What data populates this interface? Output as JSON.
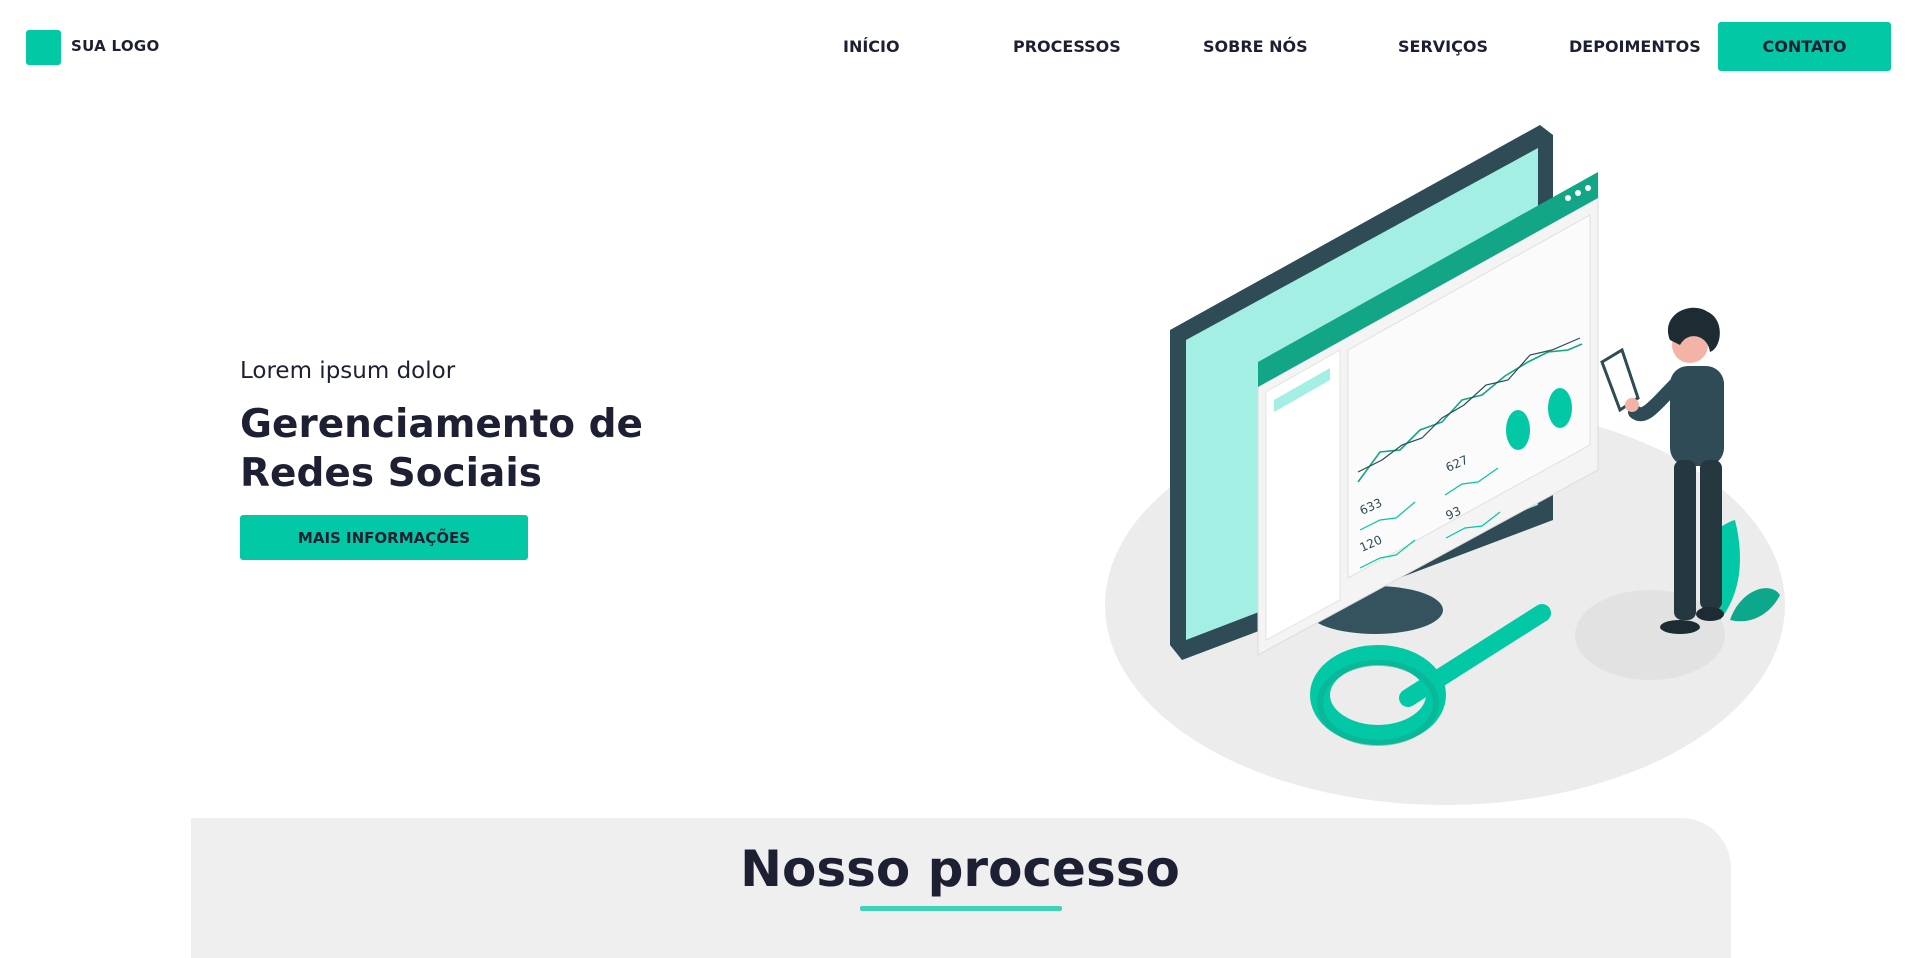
{
  "nav": {
    "logo_text": "SUA LOGO",
    "links": [
      "INÍCIO",
      "PROCESSOS",
      "SOBRE NÓS",
      "SERVIÇOS",
      "DEPOIMENTOS"
    ],
    "cta": "CONTATO"
  },
  "hero": {
    "kicker": "Lorem ipsum dolor",
    "title": "Gerenciamento de Redes Sociais",
    "button": "MAIS INFORMAÇÕES",
    "illustration": {
      "stats": [
        "627",
        "633",
        "93",
        "120"
      ]
    }
  },
  "process": {
    "title": "Nosso processo"
  },
  "colors": {
    "accent": "#02c8a6",
    "text": "#1d2033",
    "section_bg": "#efefef"
  }
}
